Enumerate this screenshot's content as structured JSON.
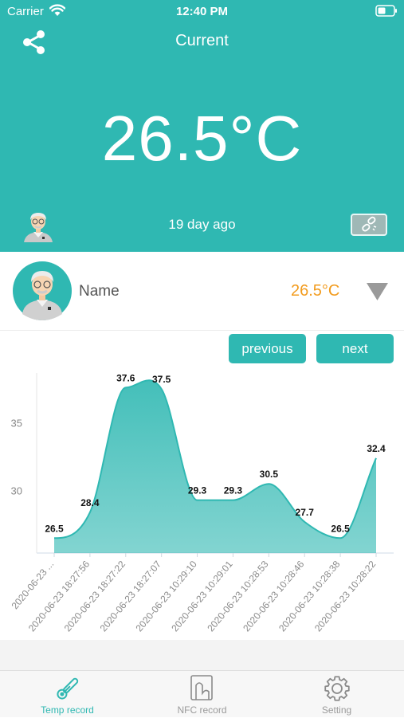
{
  "status_bar": {
    "carrier": "Carrier",
    "time": "12:40 PM"
  },
  "header": {
    "title": "Current",
    "temperature": "26.5°C",
    "time_ago": "19 day ago",
    "background_color": "#2fb8b2"
  },
  "profile": {
    "name": "Name",
    "temperature": "26.5°C",
    "temperature_color": "#f29b1d"
  },
  "nav": {
    "previous": "previous",
    "next": "next"
  },
  "chart_data": {
    "type": "area",
    "x": [
      "2020-06-23 ...",
      "2020-06-23 18:27:56",
      "2020-06-23 18:27:22",
      "2020-06-23 18:27:07",
      "2020-06-23 10:29:10",
      "2020-06-23 10:29:01",
      "2020-06-23 10:28:53",
      "2020-06-23 10:28:46",
      "2020-06-23 10:28:38",
      "2020-06-23 10:28:22"
    ],
    "values": [
      26.5,
      28.4,
      37.6,
      37.5,
      29.3,
      29.3,
      30.5,
      27.7,
      26.5,
      32.4
    ],
    "y_ticks": [
      30,
      35
    ],
    "ylim": [
      25.4,
      38.8
    ],
    "color": "#2fb8b2",
    "grid": false
  },
  "tabs": [
    {
      "label": "Temp record",
      "icon": "thermometer-icon",
      "active": true
    },
    {
      "label": "NFC record",
      "icon": "nfc-card-icon",
      "active": false
    },
    {
      "label": "Setting",
      "icon": "gear-icon",
      "active": false
    }
  ]
}
